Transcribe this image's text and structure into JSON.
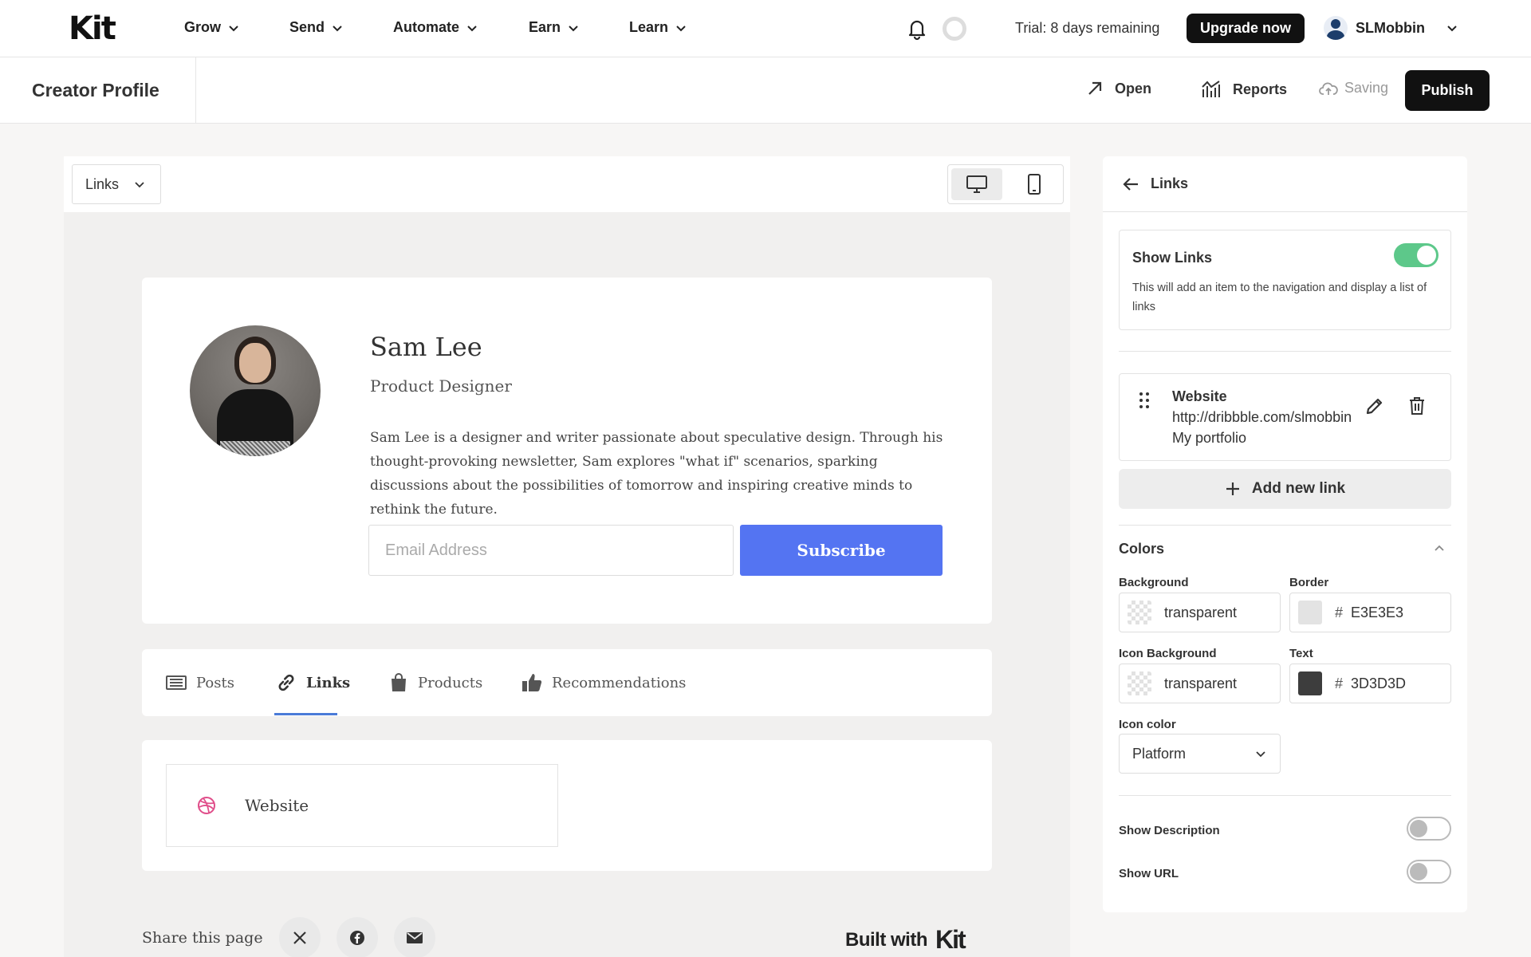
{
  "topnav": {
    "logo": "Kit",
    "items": [
      "Grow",
      "Send",
      "Automate",
      "Earn",
      "Learn"
    ],
    "trial": "Trial: 8 days remaining",
    "upgrade": "Upgrade now",
    "username": "SLMobbin"
  },
  "subheader": {
    "title": "Creator Profile",
    "open": "Open",
    "reports": "Reports",
    "saving": "Saving",
    "publish": "Publish"
  },
  "preview": {
    "section_select": "Links",
    "profile": {
      "name": "Sam Lee",
      "role": "Product Designer",
      "bio": "Sam Lee is a designer and writer passionate about speculative design. Through his thought-provoking newsletter, Sam explores \"what if\" scenarios, sparking discussions about the possibilities of tomorrow and inspiring creative minds to rethink the future.",
      "email_placeholder": "Email Address",
      "subscribe": "Subscribe"
    },
    "tabs": [
      {
        "label": "Posts",
        "icon": "newspaper-icon"
      },
      {
        "label": "Links",
        "icon": "link-icon"
      },
      {
        "label": "Products",
        "icon": "shopping-bag-icon"
      },
      {
        "label": "Recommendations",
        "icon": "thumbs-up-icon"
      }
    ],
    "active_tab": "Links",
    "link_tiles": [
      {
        "label": "Website",
        "icon": "dribbble-icon"
      }
    ],
    "share_label": "Share this page",
    "built_with": "Built with",
    "built_logo": "Kit"
  },
  "panel": {
    "title": "Links",
    "show_links": {
      "title": "Show Links",
      "description": "This will add an item to the navigation and display a list of links",
      "enabled": true
    },
    "links": [
      {
        "title": "Website",
        "url": "http://dribbble.com/slmobbin",
        "description": "My portfolio"
      }
    ],
    "add_link": "Add new link",
    "colors": {
      "title": "Colors",
      "background_label": "Background",
      "background_value": "transparent",
      "border_label": "Border",
      "border_value": "E3E3E3",
      "icon_bg_label": "Icon Background",
      "icon_bg_value": "transparent",
      "text_label": "Text",
      "text_value": "3D3D3D",
      "hash": "#"
    },
    "icon_color": {
      "label": "Icon color",
      "value": "Platform"
    },
    "show_description": {
      "label": "Show Description",
      "enabled": false
    },
    "show_url": {
      "label": "Show URL",
      "enabled": false
    }
  },
  "colors": {
    "accent_green": "#5dc88a",
    "subscribe_blue": "#5474f2",
    "tab_underline": "#4a7bd8",
    "dribbble_pink": "#e04e8a",
    "border_swatch": "#E3E3E3",
    "text_swatch": "#3D3D3D"
  }
}
